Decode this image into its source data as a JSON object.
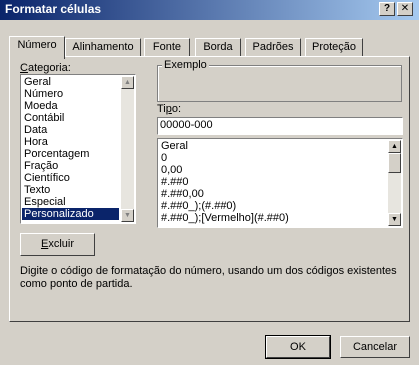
{
  "window": {
    "title": "Formatar células",
    "help_glyph": "?",
    "close_glyph": "✕"
  },
  "tabs": [
    {
      "label": "Número",
      "active": true
    },
    {
      "label": "Alinhamento",
      "active": false
    },
    {
      "label": "Fonte",
      "active": false
    },
    {
      "label": "Borda",
      "active": false
    },
    {
      "label": "Padrões",
      "active": false
    },
    {
      "label": "Proteção",
      "active": false
    }
  ],
  "category": {
    "label": "Categoria:",
    "items": [
      "Geral",
      "Número",
      "Moeda",
      "Contábil",
      "Data",
      "Hora",
      "Porcentagem",
      "Fração",
      "Científico",
      "Texto",
      "Especial",
      "Personalizado"
    ],
    "selected": "Personalizado"
  },
  "sample": {
    "legend": "Exemplo",
    "value": ""
  },
  "type": {
    "label": "Tipo:",
    "value": "00000-000",
    "items": [
      "Geral",
      "0",
      "0,00",
      "#.##0",
      "#.##0,00",
      "#.##0_);(#.##0)",
      "#.##0_);[Vermelho](#.##0)"
    ]
  },
  "buttons": {
    "delete": "Excluir",
    "ok": "OK",
    "cancel": "Cancelar"
  },
  "description": "Digite o código de formatação do número, usando um dos códigos existentes como ponto de partida.",
  "colors": {
    "titlebar_start": "#0a246a",
    "titlebar_end": "#a6caf0",
    "selection": "#0a246a",
    "face": "#d4d0c8",
    "backdrop": "#1f7a3a"
  },
  "icons": {
    "scroll_up": "▲",
    "scroll_down": "▼"
  }
}
